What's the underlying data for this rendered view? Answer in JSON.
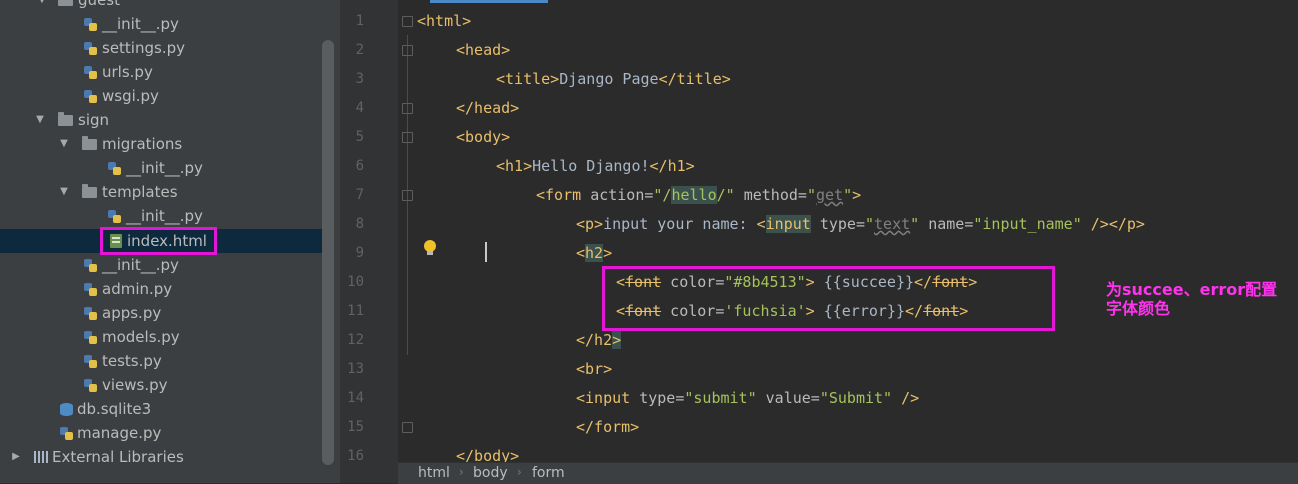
{
  "project_tree": {
    "items": [
      {
        "label": "guest",
        "type": "folder"
      },
      {
        "label": "__init__.py",
        "type": "py"
      },
      {
        "label": "settings.py",
        "type": "py"
      },
      {
        "label": "urls.py",
        "type": "py"
      },
      {
        "label": "wsgi.py",
        "type": "py"
      },
      {
        "label": "sign",
        "type": "folder"
      },
      {
        "label": "migrations",
        "type": "folder"
      },
      {
        "label": "__init__.py",
        "type": "py"
      },
      {
        "label": "templates",
        "type": "folder"
      },
      {
        "label": "__init__.py",
        "type": "py"
      },
      {
        "label": "index.html",
        "type": "html",
        "selected": true
      },
      {
        "label": "__init__.py",
        "type": "py"
      },
      {
        "label": "admin.py",
        "type": "py"
      },
      {
        "label": "apps.py",
        "type": "py"
      },
      {
        "label": "models.py",
        "type": "py"
      },
      {
        "label": "tests.py",
        "type": "py"
      },
      {
        "label": "views.py",
        "type": "py"
      },
      {
        "label": "db.sqlite3",
        "type": "db"
      },
      {
        "label": "manage.py",
        "type": "py"
      },
      {
        "label": "External Libraries",
        "type": "lib"
      }
    ]
  },
  "editor": {
    "line_numbers": [
      "1",
      "2",
      "3",
      "4",
      "5",
      "6",
      "7",
      "8",
      "9",
      "10",
      "11",
      "12",
      "13",
      "14",
      "15",
      "16"
    ],
    "lines": {
      "l1": [
        "<html>"
      ],
      "l2": [
        "<head>"
      ],
      "l3": [
        "<title>",
        "Django Page",
        "</title>"
      ],
      "l4": [
        "</head>"
      ],
      "l5": [
        "<body>"
      ],
      "l6": [
        "<h1>",
        "Hello Django!",
        "</h1>"
      ],
      "l7": [
        "<form ",
        "action=",
        "\"/",
        "hello",
        "/\"",
        " method=",
        "\"",
        "get",
        "\"",
        ">"
      ],
      "l8": [
        "<p>",
        "input your name: ",
        "<",
        "input",
        " type=",
        "\"",
        "text",
        "\"",
        " name=",
        "\"input_name\"",
        " />",
        "</p>"
      ],
      "l9": [
        "<",
        "h2",
        ">"
      ],
      "l10": [
        "<",
        "font",
        " color=",
        "\"#8b4513\"",
        ">",
        " {{succee}}",
        "</",
        "font",
        ">"
      ],
      "l11": [
        "<",
        "font",
        " color=",
        "'fuchsia'",
        ">",
        " {{error}}",
        "</",
        "font",
        ">"
      ],
      "l12": [
        "</h2",
        ">"
      ],
      "l13": [
        "<br>"
      ],
      "l14": [
        "<input ",
        "type=",
        "\"submit\"",
        " value=",
        "\"Submit\"",
        " />"
      ],
      "l15": [
        "</form>"
      ],
      "l16": [
        "</body>"
      ]
    }
  },
  "annotation": {
    "note_line1": "为succee、error配置",
    "note_line2": "字体颜色",
    "color": "#ff33ee"
  },
  "breadcrumb": [
    "html",
    "body",
    "form"
  ]
}
